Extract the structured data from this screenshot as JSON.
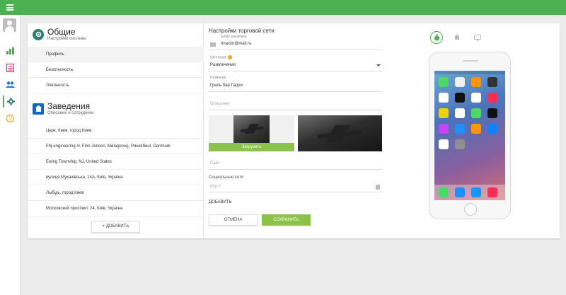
{
  "general": {
    "title": "Общие",
    "subtitle": "Настройки системы",
    "items": [
      {
        "label": "Профиль"
      },
      {
        "label": "Безопасность"
      },
      {
        "label": "Лояльность"
      }
    ]
  },
  "venues": {
    "title": "Заведения",
    "subtitle": "Описание и сотрудники",
    "items": [
      {
        "label": "Церк, Киев, город Киев"
      },
      {
        "label": "Fhj-engineering /v. Finn Jensen, Mølagervej, Ринкёбинг, Danmark"
      },
      {
        "label": "Ewing Township, NJ, United States"
      },
      {
        "label": "вулиця Мукачівська, 14А, Київ, Україна"
      },
      {
        "label": "Лыбідь, город Киев"
      },
      {
        "label": "Московский проспект, 24, Київ, Україна"
      }
    ],
    "add_label": "+ ДОБАВИТЬ"
  },
  "form": {
    "title": "Настройки торговой сети",
    "email_label": "Email заказчика",
    "email_value": "tmaxim@mail.ru",
    "category_label": "Категория",
    "category_value": "Развлечения",
    "name_label": "Название",
    "name_value": "Гриль бар Гарри",
    "description_placeholder": "Описание",
    "upload_label": "Загрузить",
    "site_placeholder": "Сайт",
    "social_label": "Социальные сети",
    "social_placeholder": "http://",
    "add_social_label": "ДОБАВИТЬ",
    "cancel_label": "ОТМЕНА",
    "save_label": "СОХРАНИТЬ"
  },
  "preview": {
    "os_tabs": [
      {
        "icon": "apple-icon",
        "active": true
      },
      {
        "icon": "android-icon",
        "active": false
      },
      {
        "icon": "desktop-icon",
        "active": false
      }
    ]
  },
  "colors": {
    "accent": "#4caf50",
    "button_green": "#8bc34a",
    "section_icon": "#2e7d6e"
  }
}
